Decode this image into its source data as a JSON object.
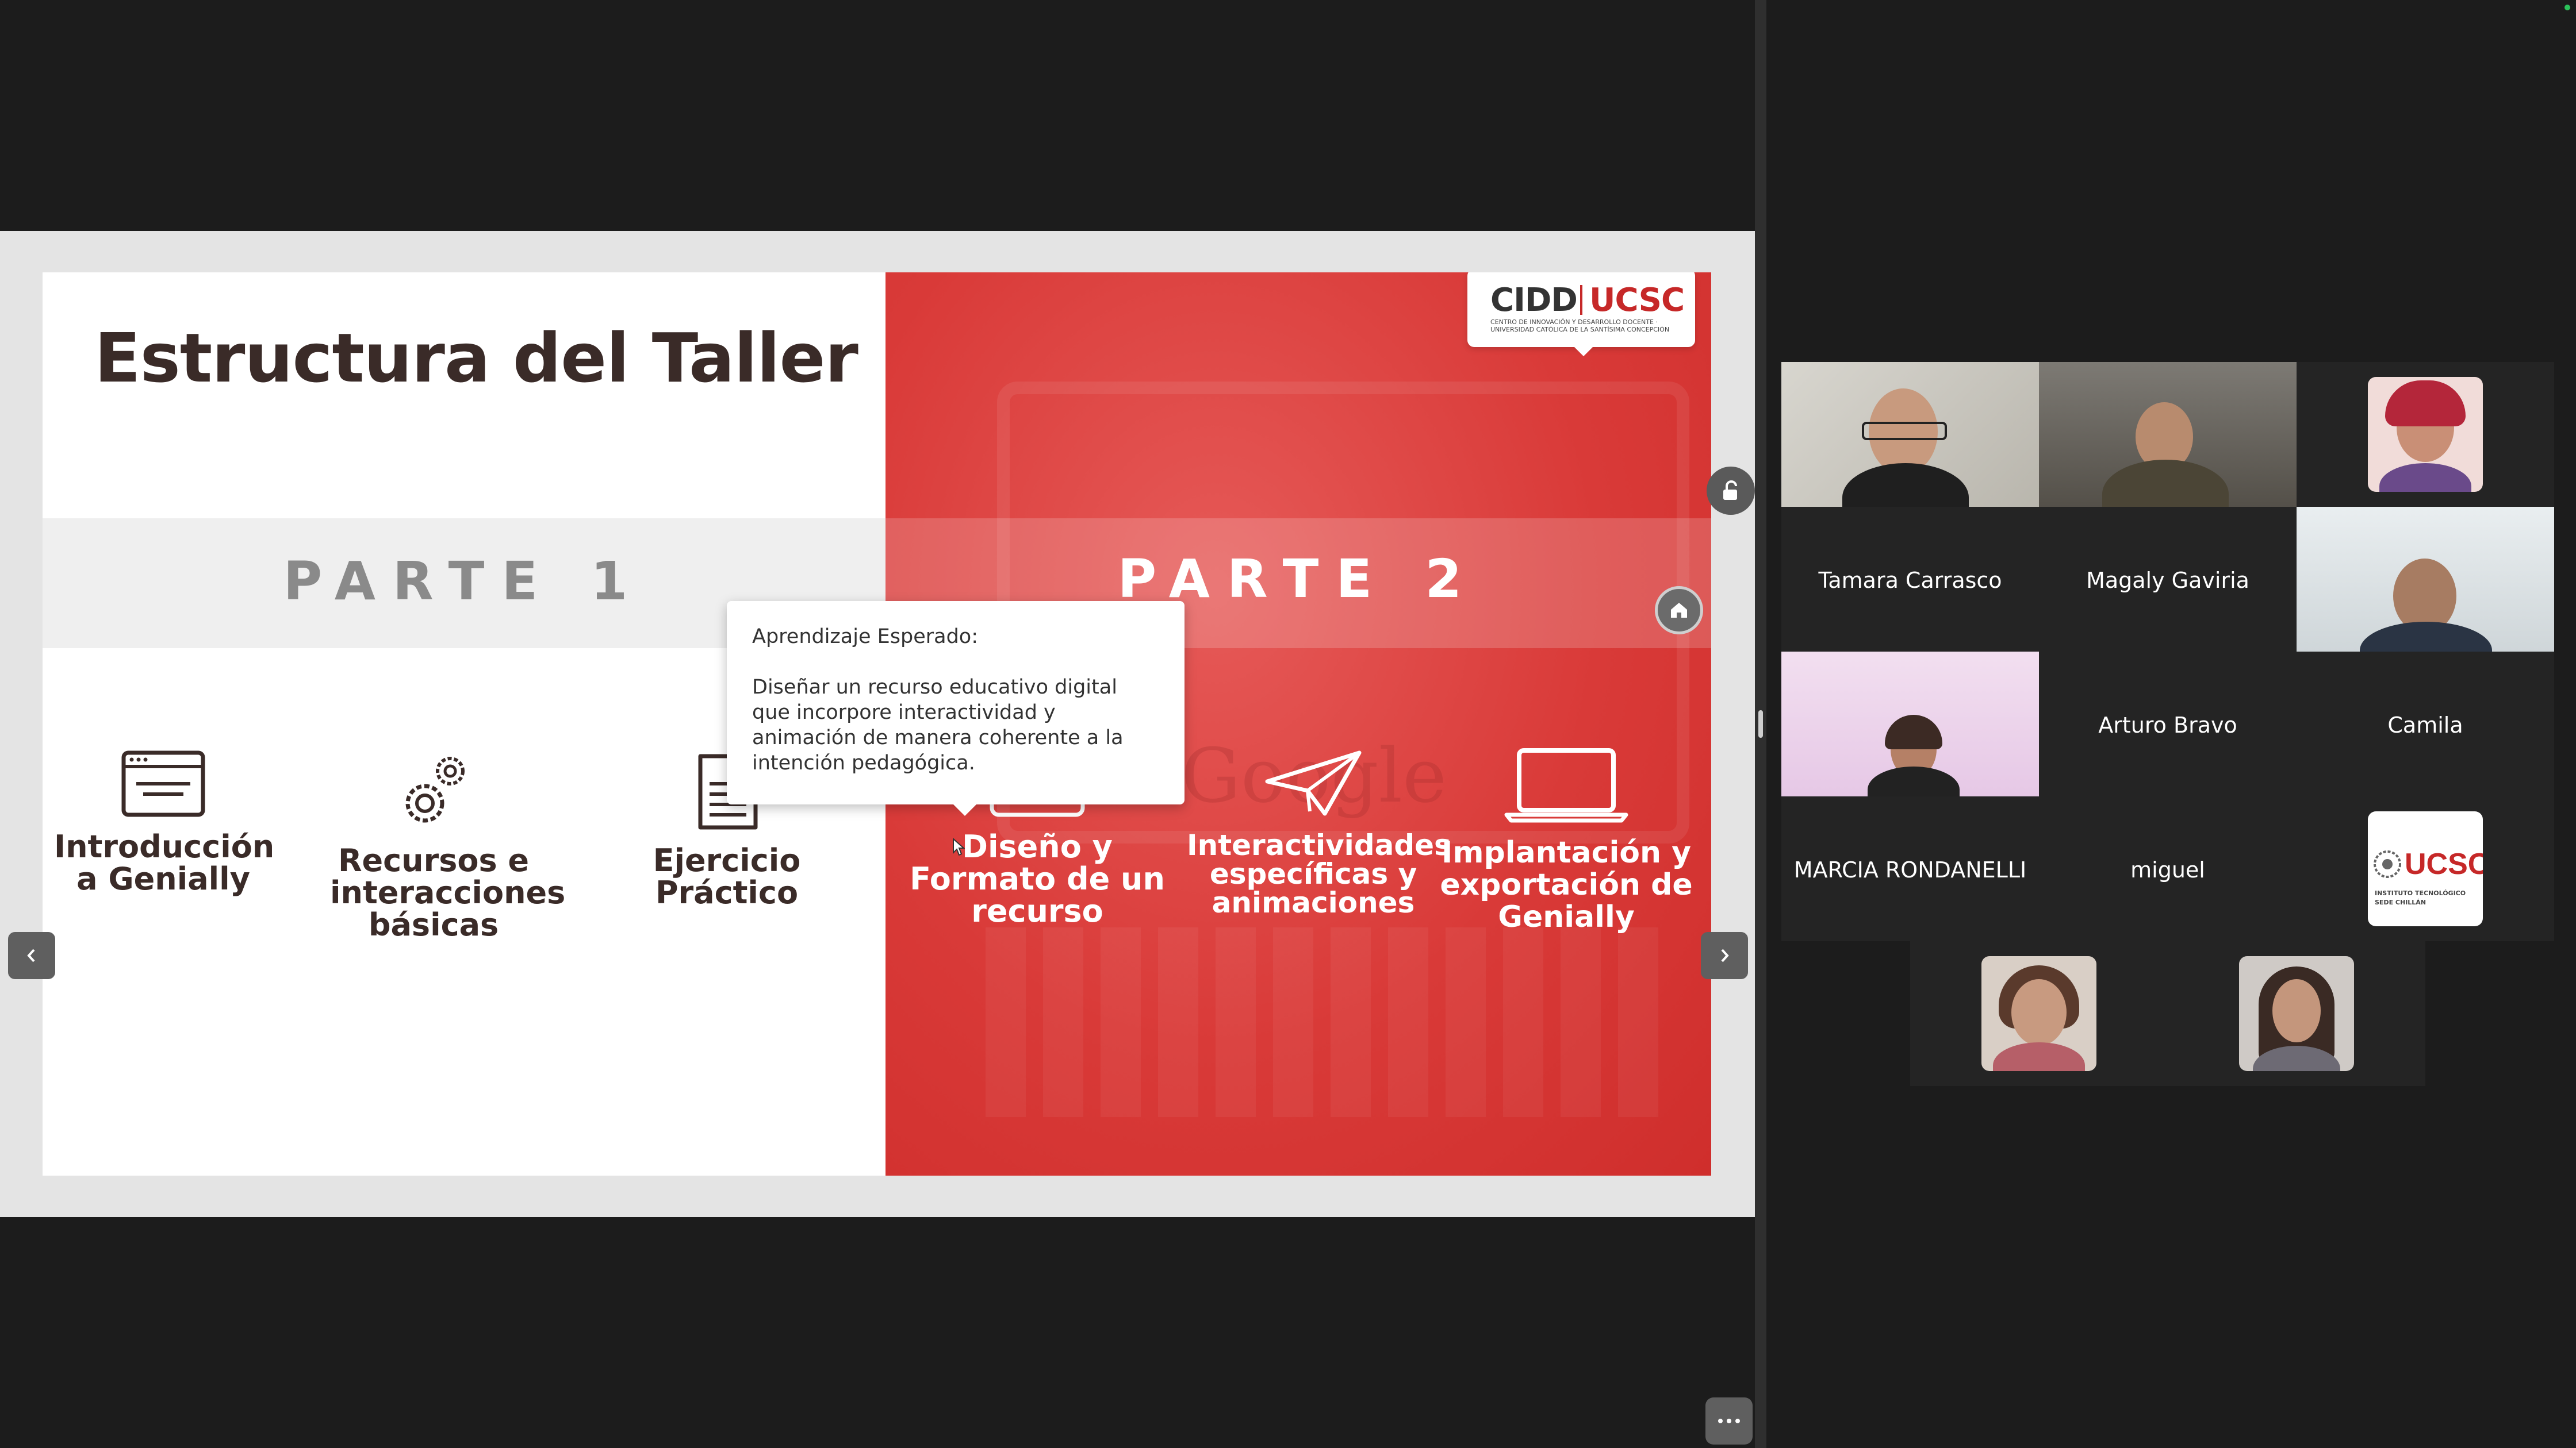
{
  "slide": {
    "title": "Estructura del Taller",
    "part1": "PARTE 1",
    "part2": "PARTE 2",
    "topics_part1": [
      {
        "label": "Introducción a Genially",
        "icon": "browser-window-icon"
      },
      {
        "label": "Recursos e interacciones básicas",
        "icon": "gears-icon"
      },
      {
        "label": "Ejercicio Práctico",
        "icon": "document-icon"
      }
    ],
    "topics_part2": [
      {
        "label": "Diseño y Formato de un recurso",
        "icon": "chart-line-icon"
      },
      {
        "label": "Interactividades específicas y animaciones",
        "icon": "paper-plane-icon"
      },
      {
        "label": "Implantación y exportación de Genially",
        "icon": "laptop-icon"
      }
    ],
    "logo": {
      "left": "CIDD",
      "right": "UCSC",
      "subtitle": "CENTRO DE INNOVACIÓN Y DESARROLLO DOCENTE · UNIVERSIDAD CATÓLICA DE LA SANTÍSIMA CONCEPCIÓN"
    },
    "watermark": "Google"
  },
  "tooltip": {
    "heading": "Aprendizaje Esperado:",
    "body": "Diseñar un recurso educativo digital que incorpore interactividad y animación de manera coherente a la intención pedagógica."
  },
  "participants": [
    {
      "name": "Tamara Carrasco",
      "video": true,
      "active": true
    },
    {
      "name": "Magaly Gaviria",
      "video": true
    },
    {
      "name": "Arturo Bravo",
      "video": false
    },
    {
      "name": "Camila",
      "video": true
    },
    {
      "name": "MARCIA RONDANELLI",
      "video": true
    },
    {
      "name": "miguel",
      "video": false
    },
    {
      "name": "",
      "video": true
    },
    {
      "name": "",
      "video": true
    }
  ],
  "ucsc_badge": {
    "name": "UCSC",
    "line1": "INSTITUTO TECNOLÓGICO",
    "line2": "SEDE CHILLÁN"
  },
  "colors": {
    "accent_red": "#d93a38",
    "active_speaker": "#2bc159",
    "title_text": "#3a2b28"
  }
}
